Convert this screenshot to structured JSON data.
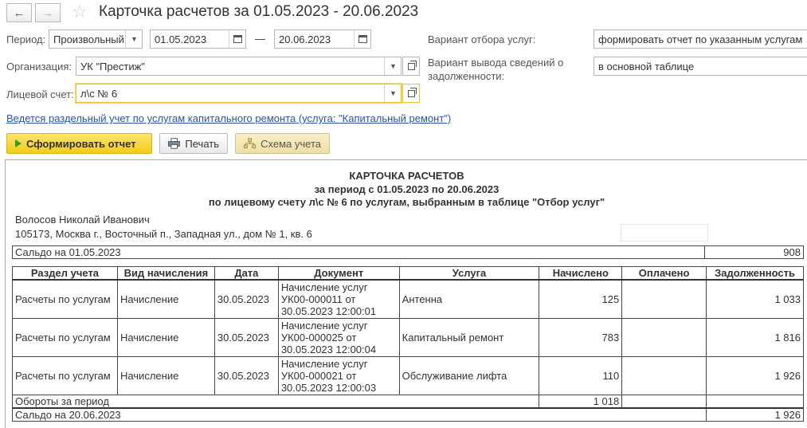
{
  "window": {
    "title": "Карточка расчетов  за 01.05.2023 - 20.06.2023",
    "back_icon": "arrow-left",
    "forward_icon": "arrow-right",
    "favorite_icon": "star"
  },
  "form": {
    "period_label": "Период:",
    "period_type": "Произвольный",
    "date_from": "01.05.2023",
    "dash": "—",
    "date_to": "20.06.2023",
    "org_label": "Организация:",
    "org_value": "УК \"Престиж\"",
    "account_label": "Лицевой счет:",
    "account_value": "л\\с № 6",
    "service_filter_label": "Вариант отбора услуг:",
    "service_filter_value": "формировать отчет по указанным услугам",
    "debt_output_label_line1": "Вариант вывода сведений о",
    "debt_output_label_line2": "задолженности:",
    "debt_output_value": "в основной таблице",
    "capital_repair_link": "Ведется раздельный учет по услугам капитального ремонта (услуга: \"Капитальный ремонт\")"
  },
  "toolbar": {
    "generate_label": "Сформировать отчет",
    "print_label": "Печать",
    "schema_label": "Схема учета"
  },
  "report": {
    "title": "КАРТОЧКА РАСЧЕТОВ",
    "period_line": "за период с 01.05.2023 по 20.06.2023",
    "account_line": "по лицевому счету л\\с № 6 по услугам, выбранным в таблице \"Отбор услуг\"",
    "person": "Волосов Николай Иванович",
    "address": "105173, Москва г., Восточный п., Западная ул., дом № 1, кв. 6",
    "opening_label": "Сальдо на 01.05.2023",
    "opening_value": "908",
    "columns": [
      "Раздел учета",
      "Вид начисления",
      "Дата",
      "Документ",
      "Услуга",
      "Начислено",
      "Оплачено",
      "Задолженность"
    ],
    "rows": [
      {
        "section": "Расчеты по услугам",
        "kind": "Начисление",
        "date": "30.05.2023",
        "doc1": "Начисление услуг",
        "doc2": "УК00-000011 от",
        "doc3": "30.05.2023 12:00:01",
        "service": "Антенна",
        "accrued": "125",
        "paid": "",
        "debt": "1 033"
      },
      {
        "section": "Расчеты по услугам",
        "kind": "Начисление",
        "date": "30.05.2023",
        "doc1": "Начисление услуг",
        "doc2": "УК00-000025 от",
        "doc3": "30.05.2023 12:00:04",
        "service": "Капитальный ремонт",
        "accrued": "783",
        "paid": "",
        "debt": "1 816"
      },
      {
        "section": "Расчеты по услугам",
        "kind": "Начисление",
        "date": "30.05.2023",
        "doc1": "Начисление услуг",
        "doc2": "УК00-000021 от",
        "doc3": "30.05.2023 12:00:03",
        "service": "Обслуживание лифта",
        "accrued": "110",
        "paid": "",
        "debt": "1 926"
      }
    ],
    "turnover_label": "Обороты за период",
    "turnover_accrued": "1 018",
    "closing_label": "Сальдо на 20.06.2023",
    "closing_value": "1 926"
  }
}
